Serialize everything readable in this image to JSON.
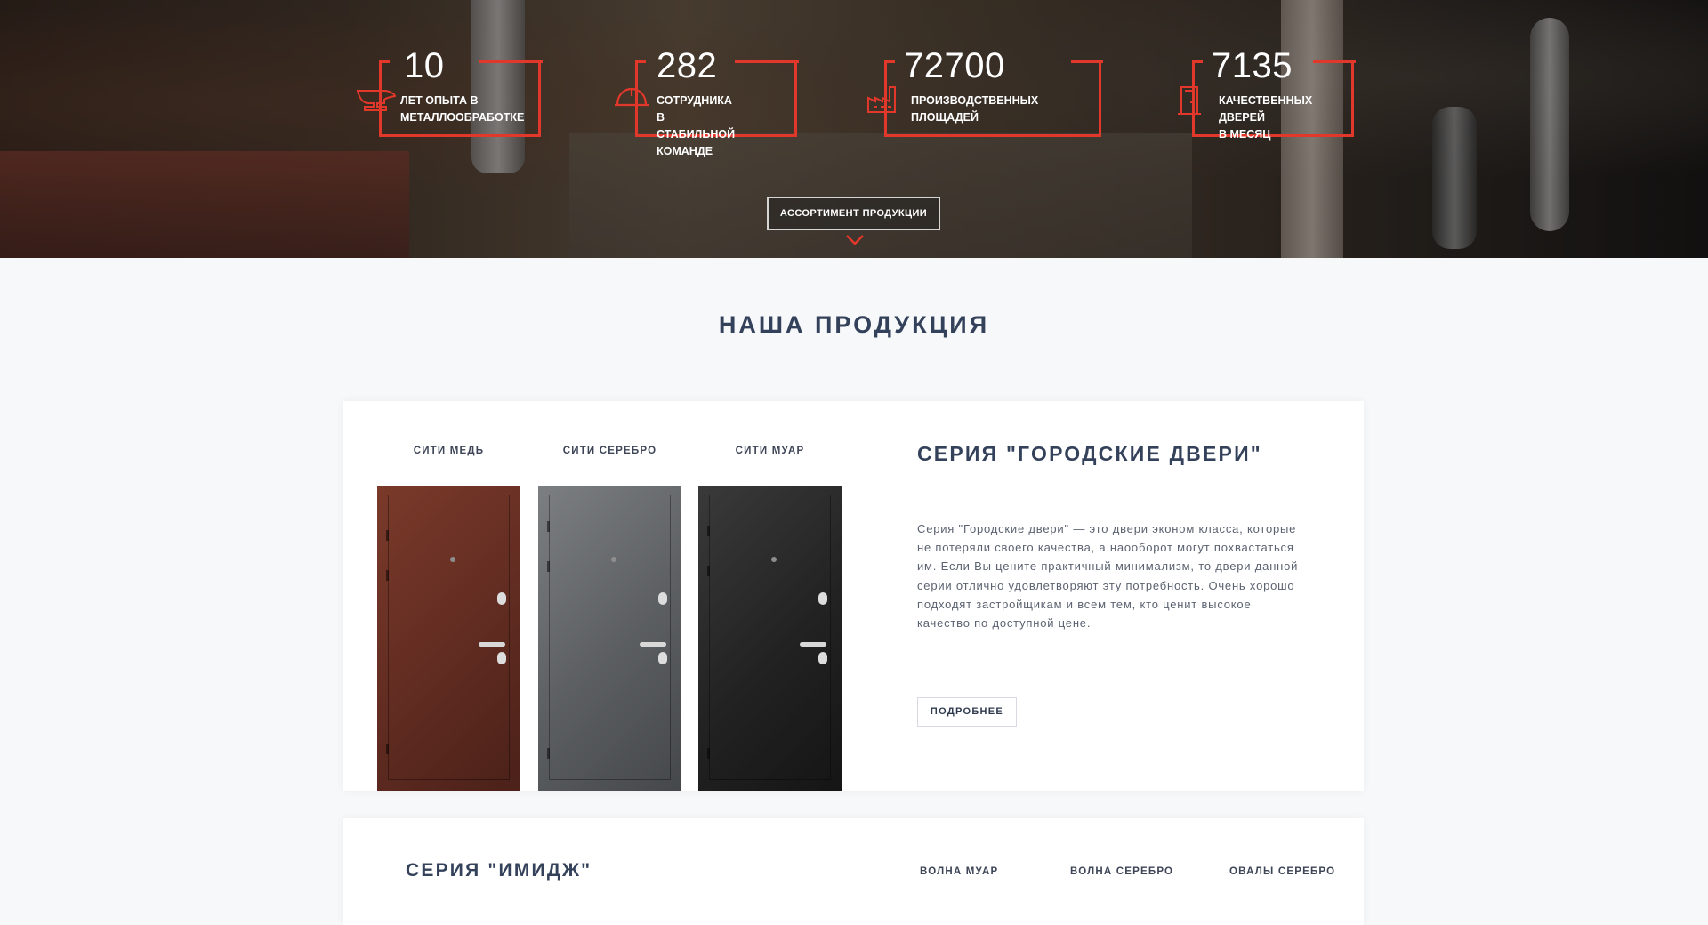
{
  "colors": {
    "accent": "#e2382b",
    "heading": "#34415a",
    "page_bg": "#f7f8fa"
  },
  "hero": {
    "stats": [
      {
        "value": "10",
        "label_line1": "ЛЕТ ОПЫТА В",
        "label_line2": "МЕТАЛЛООБРАБОТКЕ",
        "icon": "anvil-icon"
      },
      {
        "value": "282",
        "label_line1": "СОТРУДНИКА В СТАБИЛЬНОЙ",
        "label_line2": "КОМАНДЕ",
        "icon": "hard-hat-icon"
      },
      {
        "value": "72700",
        "label_line1": "ПРОИЗВОДСТВЕННЫХ",
        "label_line2": "ПЛОЩАДЕЙ",
        "icon": "factory-icon"
      },
      {
        "value": "7135",
        "label_line1": "КАЧЕСТВЕННЫХ ДВЕРЕЙ",
        "label_line2": "В МЕСЯЦ",
        "icon": "door-icon"
      }
    ],
    "assortment_button": "АССОРТИМЕНТ ПРОДУКЦИИ"
  },
  "products": {
    "title": "НАША ПРОДУКЦИЯ",
    "series1": {
      "doors": [
        "СИТИ МЕДЬ",
        "СИТИ СЕРЕБРО",
        "СИТИ МУАР"
      ],
      "title": "СЕРИЯ \"ГОРОДСКИЕ ДВЕРИ\"",
      "description": "Серия \"Городские двери\" — это двери эконом класса, которые не потеряли своего качества, а наооборот могут похвастаться им. Если Вы цените практичный минимализм, то двери данной серии отлично удовлетворяют эту потребность. Очень хорошо подходят застройщикам и всем тем, кто ценит высокое качество по доступной цене.",
      "more_button": "ПОДРОБНЕЕ"
    },
    "series2": {
      "title": "СЕРИЯ \"ИМИДЖ\"",
      "doors": [
        "ВОЛНА МУАР",
        "ВОЛНА СЕРЕБРО",
        "ОВАЛЫ СЕРЕБРО"
      ]
    }
  }
}
